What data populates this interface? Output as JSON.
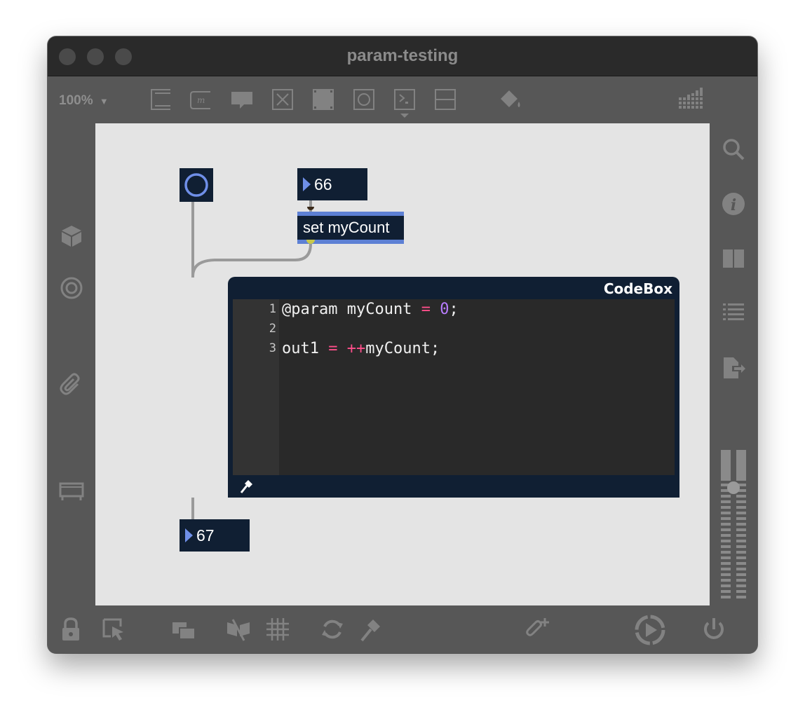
{
  "window": {
    "title": "param-testing"
  },
  "toolbar": {
    "zoom_label": "100%",
    "icons": [
      "object-box-icon",
      "message-box-icon",
      "comment-icon",
      "button-toggle-icon",
      "dial-icon",
      "bang-icon",
      "preset-icon",
      "slider-icon",
      "paint-bucket-icon",
      "grid-matrix-icon"
    ]
  },
  "patcher": {
    "number_top": "66",
    "message_label": "set myCount",
    "number_bottom": "67",
    "codebox": {
      "title": "CodeBox",
      "lines": [
        {
          "num": "1",
          "tokens": [
            {
              "t": "@param myCount ",
              "c": ""
            },
            {
              "t": "=",
              "c": "op"
            },
            {
              "t": " ",
              "c": ""
            },
            {
              "t": "0",
              "c": "num"
            },
            {
              "t": ";",
              "c": ""
            }
          ]
        },
        {
          "num": "2",
          "tokens": []
        },
        {
          "num": "3",
          "tokens": [
            {
              "t": "out1 ",
              "c": ""
            },
            {
              "t": "=",
              "c": "op"
            },
            {
              "t": " ",
              "c": ""
            },
            {
              "t": "++",
              "c": "op"
            },
            {
              "t": "myCount;",
              "c": ""
            }
          ]
        }
      ]
    }
  },
  "colors": {
    "object_bg": "#101f33",
    "message_border": "#5d80d4",
    "operator": "#ff4f8b",
    "number_literal": "#b87cff",
    "canvas_bg": "#e4e4e4"
  }
}
